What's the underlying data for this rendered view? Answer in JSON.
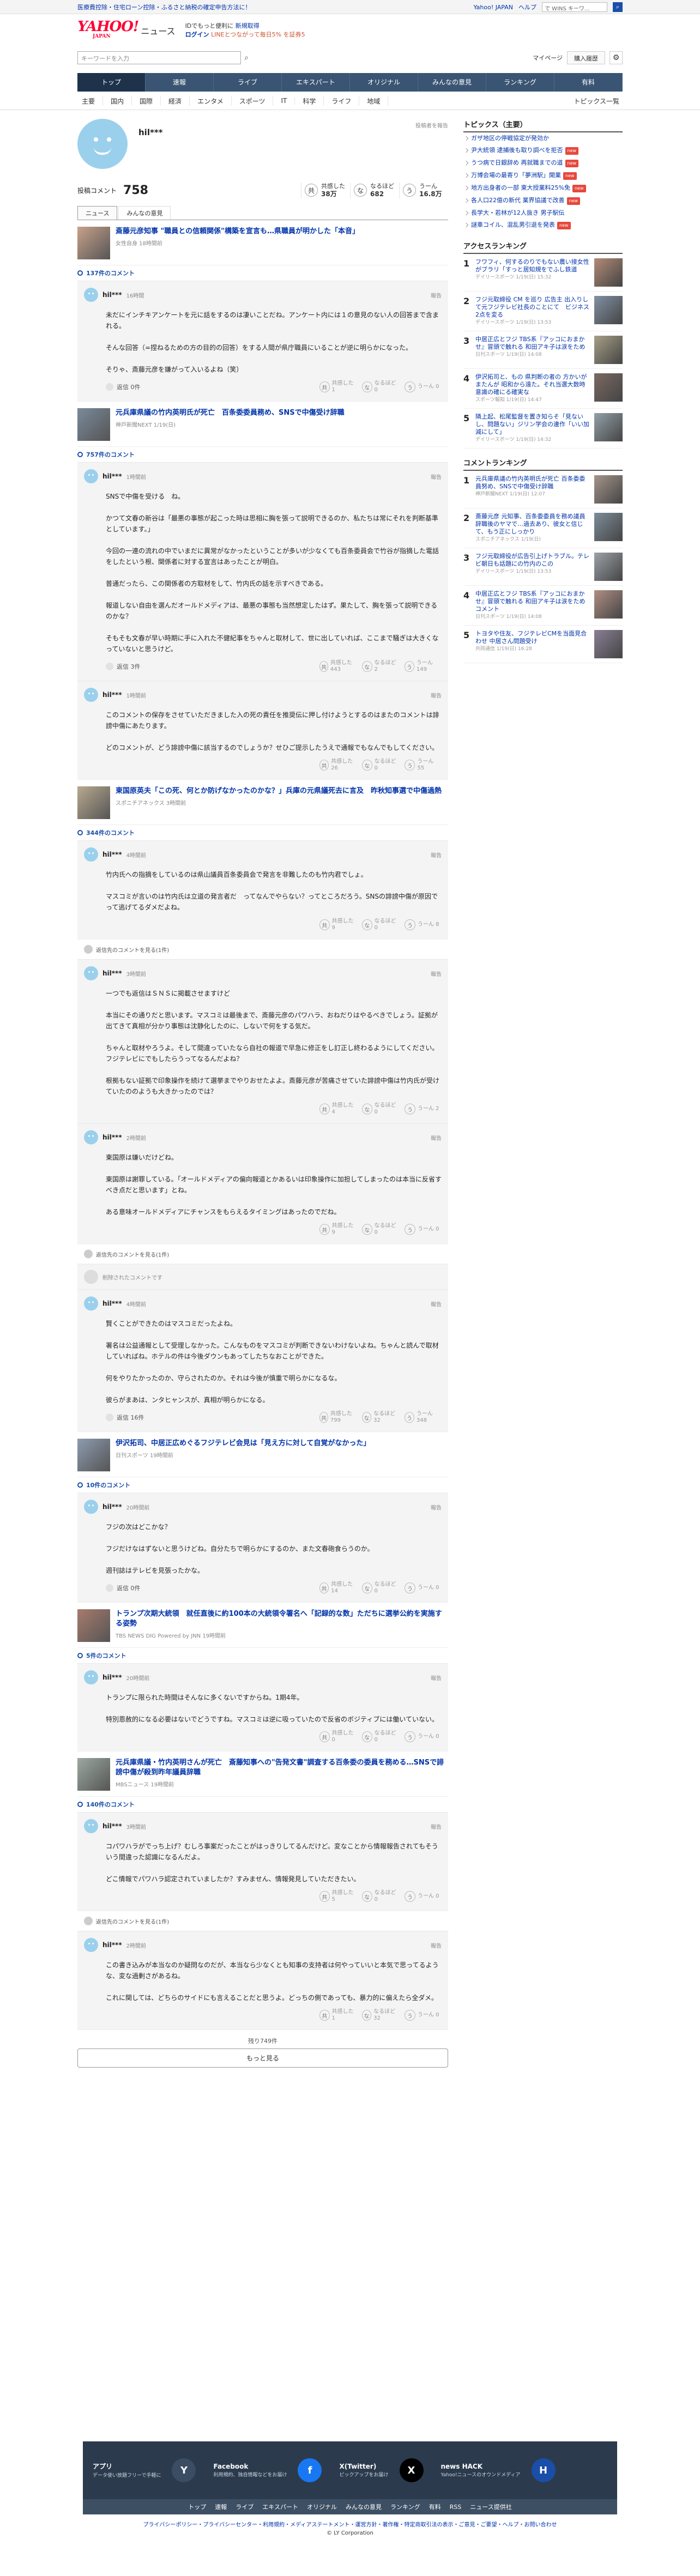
{
  "promo": {
    "left": "医療費控除・住宅ローン控除・ふるさと納税の確定申告方法に！",
    "links": [
      "Yahoo! JAPAN",
      "ヘルプ"
    ],
    "search_placeholder": "で WINS キーワ..."
  },
  "header": {
    "logo_main": "YAHOO!",
    "logo_sub": "JAPAN",
    "service": "ニュース",
    "msg1a": "IDでもっと便利に",
    "msg1b": "新規取得",
    "login": "ログイン",
    "msg2": "LINEとつながって毎日5% を証券5"
  },
  "search": {
    "placeholder": "キーワードを入力",
    "mypage": "マイページ",
    "buy": "購入履歴"
  },
  "nav": [
    "トップ",
    "速報",
    "ライブ",
    "エキスパート",
    "オリジナル",
    "みんなの意見",
    "ランキング",
    "有料"
  ],
  "subnav": [
    "主要",
    "国内",
    "国際",
    "経済",
    "エンタメ",
    "スポーツ",
    "IT",
    "科学",
    "ライフ",
    "地域"
  ],
  "subnav_all": "トピックス一覧",
  "profile": {
    "name": "hil***",
    "report": "投稿者を報告",
    "posted_label": "投稿コメント",
    "posted_count": "758",
    "reacts": [
      {
        "icon": "共",
        "label": "共感した",
        "value": "38万"
      },
      {
        "icon": "な",
        "label": "なるほど",
        "value": "682"
      },
      {
        "icon": "う",
        "label": "うーん",
        "value": "16.8万"
      }
    ],
    "tabs": [
      "ニュース",
      "みんなの意見"
    ]
  },
  "articles": [
    {
      "title": "斎藤元彦知事 \"職員との信頼関係\"構築を宣言も…県職員が明かした「本音」",
      "source": "女性自身 18時間前",
      "count": "137件のコメント",
      "comments": [
        {
          "name": "hil***",
          "time": "16時間",
          "body": [
            "未だにインチキアンケートを元に話をするのは凄いことだね。アンケート内には１の意見のない人の回答まで含まれる。",
            "そんな回答（=捏ねるための方の目的の回答）をする人間が県庁職員にいることが逆に明らかになった。",
            "そりゃ、斎藤元彦を嫌がって入いるよね（笑）"
          ],
          "reply": "返信 0件",
          "v": [
            "共感した 1",
            "なるほど 0",
            "うーん 0"
          ]
        }
      ]
    },
    {
      "title": "元兵庫県議の竹内英明氏が死亡　百条委委員務め、SNSで中傷受け辞職",
      "source": "神戸新聞NEXT 1/19(日)",
      "count": "757件のコメント",
      "comments": [
        {
          "name": "hil***",
          "time": "1時間前",
          "body": [
            "SNSで中傷を受ける　ね。",
            "かつて文春の新谷は「最悪の事態が起こった時は思相に胸を張って説明できるのか、私たちは常にそれを判断基準としています。」",
            "今回の一連の流れの中でいまだに異常がなかったということが多いが少なくても百条委員会で竹谷が指摘した電話をしたという根、関係者に対する宣言はあったことが明白。",
            "普通だったら、この関係者の方取材をして、竹内氏の話を示すべきである。",
            "報道しない自由を選んだオールドメディアは、最悪の事態も当然想定したはず。果たして、胸を張って説明できるのかな？",
            "そもそも文春が早い時期に手に入れた不健紀事をちゃんと取材して、世に出していれば、ここまで騒ぎは大きくなっていないと思うけど。"
          ],
          "reply": "返信 3件",
          "v": [
            "共感した 443",
            "なるほど 2",
            "うーん 149"
          ]
        },
        {
          "name": "hil***",
          "time": "1時間前",
          "body": [
            "このコメントの保存をさせていただきました入の死の責任を推奨伝に押し付けようとするのはまたのコメントは誹謗中傷にあたります。",
            "どのコメントが、どう誹謗中傷に該当するのでしょうか？せひご提示したうえで通報でもなんでもしてください。"
          ],
          "reply": "",
          "v": [
            "共感した 26",
            "なるほど 0",
            "うーん 55"
          ]
        }
      ]
    },
    {
      "title": "東国原英夫「この死、何とか防げなかったのかな？」兵庫の元県議死去に言及　昨秋知事選で中傷過熱",
      "source": "スポニチアネックス 3時間前",
      "count": "344件のコメント",
      "comments": [
        {
          "name": "hil***",
          "time": "4時間前",
          "body": [
            "竹内氏への指摘をしているのは県山議員百条委員会で発言を非難したのも竹内君でしょ。",
            "マスコミが言いのは竹内氏は立道の発言者だ　ってなんでやらない？ってところだろう。SNSの誹謗中傷が原因でって逃げてるダメだよね。"
          ],
          "reply": "",
          "v": [
            "共感した 9",
            "なるほど 0",
            "うーん 8"
          ]
        },
        {
          "name": "hil***",
          "time": "3時間前",
          "body": [
            "一つでも返信はＳＮＳに掲載させますけど",
            "本当にその通りだと思います。マスコミは最後まで、斎藤元彦のパワハラ、おねだりはやるべきでしょう。証拠が出てきて真相が分かり事態は沈静化したのに、しないで何をする気だ。",
            "ちゃんと取材やろうよ。そして間違っていたなら自社の報道で早急に修正をし訂正し終わるようにしてください。フジテレビにでもしたらうってなるんだよね？",
            "根拠もない証拠で印象操作を続けて選挙までやりおせたよよ。斎藤元彦が苦痛させていた誹謗中傷は竹内氏が受けていたののようも大きかったのでは？"
          ],
          "reply": "",
          "v": [
            "共感した 4",
            "なるほど 0",
            "うーん 2"
          ]
        },
        {
          "name": "hil***",
          "time": "2時間前",
          "body": [
            "東国原は嫌いだけどね。",
            "東国原は謝罪している。「オールドメディアの偏向報道とかあるいは印象操作に加担してしまったのは本当に反省すべき点だと思います」とね。",
            "ある意味オールドメディアにチャンスをもらえるタイミングはあったのでだね。"
          ],
          "reply": "",
          "v": [
            "共感した 9",
            "なるほど 0",
            "うーん 0"
          ]
        },
        {
          "name": "hil***",
          "time": "4時間前",
          "body": [
            "賢くことができたのはマスコミだったよね。",
            "署名は公益通報として受理しなかった。こんなものをマスコミが判断できないわけないよね。ちゃんと読んで取材していればね。ホテルの件は今後ダウンもあってしたちなおことができた。",
            "何をやりたかったのか、守らされたのか。それは今後が慎重で明らかになるな。",
            "彼らがまあは、ンタヒャンスが、真相が明らかになる。"
          ],
          "reply": "返信 16件",
          "v": [
            "共感した 799",
            "なるほど 32",
            "うーん 348"
          ]
        }
      ]
    },
    {
      "title": "伊沢拓司、中居正広めぐるフジテレビ会見は「見え方に対して自覚がなかった」",
      "source": "日刊スポーツ 19時間前",
      "count": "10件のコメント",
      "comments": [
        {
          "name": "hil***",
          "time": "20時間前",
          "body": [
            "フジの次はどこかな？",
            "フジだけなはずないと思うけどね。自分たちで明らかにするのか、また文春砲食らうのか。",
            "週刊誌はテレビを見張ったかな。"
          ],
          "reply": "返信 0件",
          "v": [
            "共感した 14",
            "なるほど 0",
            "うーん 0"
          ]
        }
      ]
    },
    {
      "title": "トランプ次期大統領　就任直後に約100本の大統領令署名へ「記録的な数」ただちに選挙公約を実施する姿勢",
      "source": "TBS NEWS DIG Powered by JNN 19時間前",
      "count": "5件のコメント",
      "comments": [
        {
          "name": "hil***",
          "time": "20時間前",
          "body": [
            "トランプに限られた時間はそんなに多くないですからね。1期4年。",
            "特別恩赦的になる必要はないでどうですね。マスコミは逆に吸っていたので反省のボジティブには働いていない。"
          ],
          "reply": "",
          "v": [
            "共感した 0",
            "なるほど 0",
            "うーん 0"
          ]
        }
      ]
    },
    {
      "title": "元兵庫県議・竹内英明さんが死亡　斎藤知事への\"告発文書\"調査する百条委の委員を務める…SNSで誹謗中傷が殺到昨年議員辞職",
      "source": "MBSニュース 19時間前",
      "count": "140件のコメント",
      "comments": [
        {
          "name": "hil***",
          "time": "3時間前",
          "body": [
            "コパワハラがでっち上げ？むしろ事案だったことがはっきりしてるんだけど。変なことから情報報告されてもそういう間違った認識になるんだよ。",
            "どこ情報でパワハラ認定されていましたか？すみません、情報発見していただきたい。"
          ],
          "reply": "",
          "v": [
            "共感した 5",
            "なるほど 0",
            "うーん 0"
          ]
        },
        {
          "name": "hil***",
          "time": "2時間前",
          "body": [
            "この書き込みが本当なのか疑問なのだが、本当なら少なくとも知事の支持者は何やっていいと本気で思ってるような、変な過剰さがあるね。",
            "これに関しては、どちらのサイドにも言えることだと思うよ。どっちの側であっても、暴力的に偏えたら全ダメ。"
          ],
          "reply": "",
          "v": [
            "共感した 1",
            "なるほど 32",
            "うーん 0"
          ]
        }
      ]
    }
  ],
  "show_hidden": "返信先のコメントを見る(1件)",
  "deleted_note": "削除されたコメントです",
  "more": {
    "count": "残り749件",
    "button": "もっと見る"
  },
  "topics": {
    "title": "トピックス（主要）",
    "items": [
      {
        "t": "ガザ地区の停戦協定が発効か",
        "b": ""
      },
      {
        "t": "尹大統領 逮捕後も取り調べを拒否",
        "b": "new"
      },
      {
        "t": "うつ病で日銀辞め 再就職までの道",
        "b": "new"
      },
      {
        "t": "万博会場の最寄り「夢洲駅」開業",
        "b": "new"
      },
      {
        "t": "地方出身者の一部 東大授業料25%免",
        "b": "new"
      },
      {
        "t": "各人口22億の新代 業界協議で改善",
        "b": "new"
      },
      {
        "t": "長学大・若林が12人抜き 男子駅伝",
        "b": ""
      },
      {
        "t": "謎車コイル、混乱男引退を発表",
        "b": "new"
      }
    ]
  },
  "access": {
    "title": "アクセスランキング",
    "items": [
      {
        "t": "フワフィ、何するのりでもない農い接女性がブラリ「すっと居知規をでふし鉄道",
        "s": "デイリースポーツ 1/19(日) 15:32"
      },
      {
        "t": "フジ元取締役 CM を巡り 広告主 出入りして元フジテレビ社長のことにて　ビジネス2点を変る",
        "s": "デイリースポーツ 1/19(日) 13:53"
      },
      {
        "t": "中居正広とフジ TBS系『アッコにおまかせ』冒頭で触れる 和田アキ子は涙をため",
        "s": "日刊スポーツ 1/19(日) 14:08"
      },
      {
        "t": "伊沢拓司と、もの 県判断の者の 方かいがまたんが 昭和から遠た。それ当選大数時意識の確にる確実な",
        "s": "スポーツ報知 1/19(日) 14:47"
      },
      {
        "t": "隣上起、松尾監督を置き知らそ「見ないし、問題ない」ジリン学会の連作「いい加減にして」",
        "s": "デイリースポーツ 1/19(日) 14:32"
      }
    ]
  },
  "comment_rank": {
    "title": "コメントランキング",
    "items": [
      {
        "t": "元兵庫県議の竹内英明氏が死亡 百条委委員努め、SNSで中傷受け辞職",
        "s": "神戸新聞NEXT 1/19(日) 12:07"
      },
      {
        "t": "斎藤元彦 元知事、百条委委員を務め議員辞職後のヤマで…過去あり、彼女と信じて、もう正にしっかり",
        "s": "スポニチアネックス 1/19(日)"
      },
      {
        "t": "フジ元取締役が広告引上げトラブル。テレビ朝日も話題にの竹内のこの",
        "s": "デイリースポーツ 1/19(日) 13:53"
      },
      {
        "t": "中居正広とフジ TBS系『アッコにおまかせ』冒頭で触れる 和田アキ子は涙をためコメント",
        "s": "日刊スポーツ 1/19(日) 14:08"
      },
      {
        "t": "トヨタや住友、フジテレビCMを当面見合わせ 中居さん問題受け",
        "s": "共同通信 1/19(日) 16:28"
      }
    ]
  },
  "footer": {
    "apps": [
      {
        "t": "アプリ",
        "s": "データ使い放題フリーで手軽に"
      },
      {
        "t": "Facebook",
        "s": "利用規約、独自情報などをお届け"
      },
      {
        "t": "X(Twitter)",
        "s": "ピックアップをお届け"
      },
      {
        "t": "news HACK",
        "s": "Yahoo!ニュースのオウンドメディア"
      }
    ],
    "links": [
      "トップ",
      "速報",
      "ライブ",
      "エキスパート",
      "オリジナル",
      "みんなの意見",
      "ランキング",
      "有料",
      "RSS",
      "ニュース提供社"
    ],
    "bottom": "プライバシーポリシー・プライバシーセンター・利用規約・メディアステートメント・運営方針・著作権・特定商取引法の表示・ご意見・ご要望・ヘルプ・お問い合わせ",
    "copy": "© LY Corporation"
  }
}
